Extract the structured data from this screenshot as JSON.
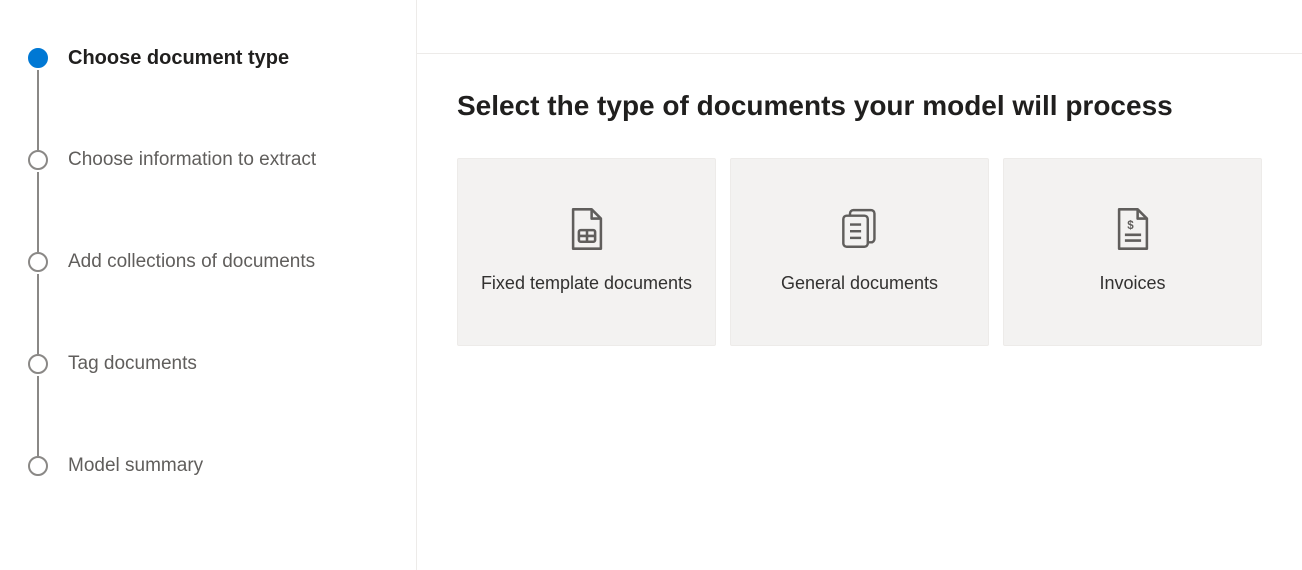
{
  "sidebar": {
    "steps": [
      {
        "label": "Choose document type",
        "active": true
      },
      {
        "label": "Choose information to extract",
        "active": false
      },
      {
        "label": "Add collections of documents",
        "active": false
      },
      {
        "label": "Tag documents",
        "active": false
      },
      {
        "label": "Model summary",
        "active": false
      }
    ]
  },
  "main": {
    "heading": "Select the type of documents your model will process",
    "cards": [
      {
        "label": "Fixed template documents",
        "icon": "template-document-icon"
      },
      {
        "label": "General documents",
        "icon": "general-document-icon"
      },
      {
        "label": "Invoices",
        "icon": "invoice-icon"
      }
    ]
  }
}
